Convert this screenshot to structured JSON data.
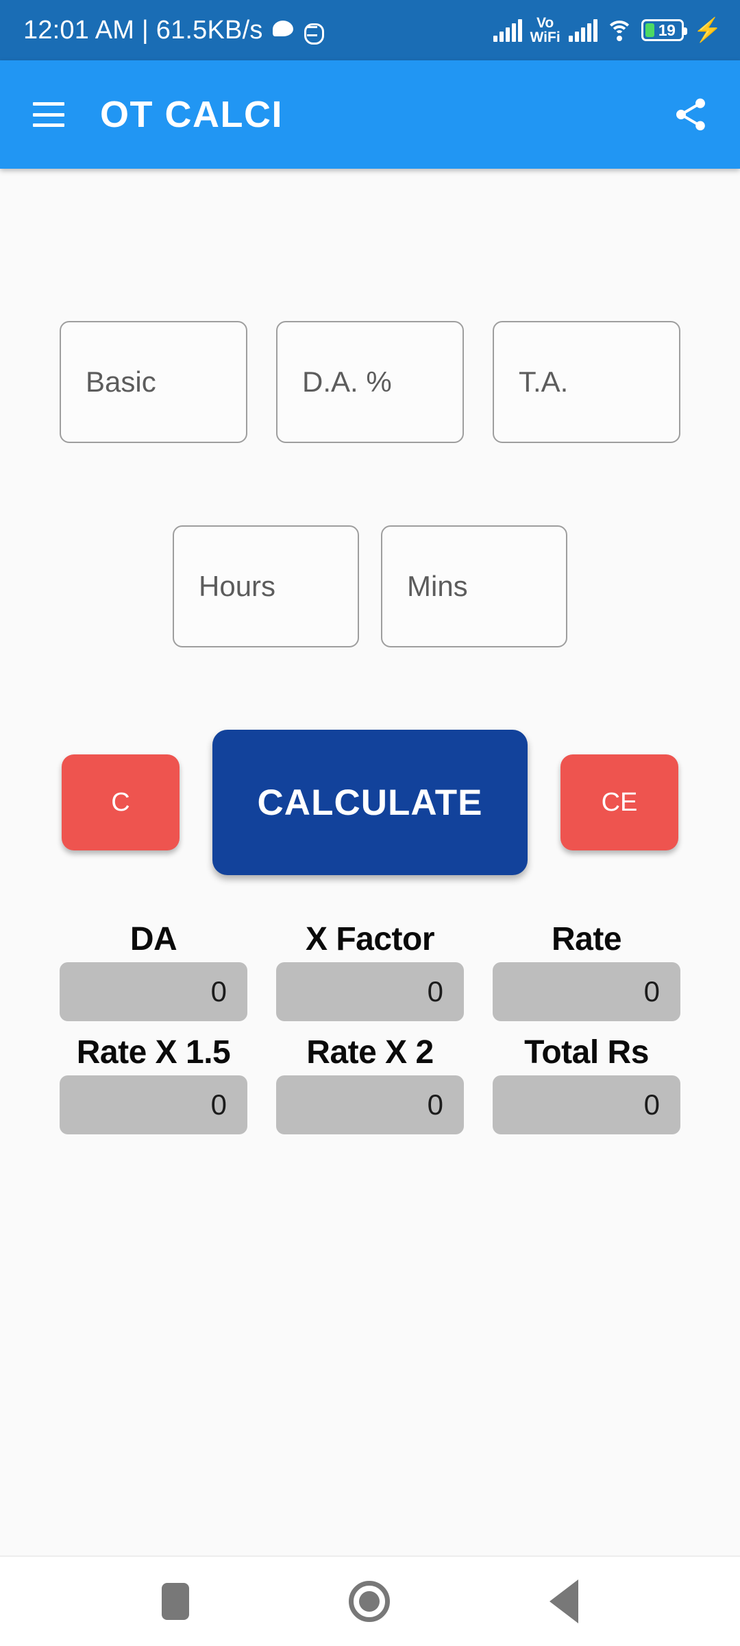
{
  "status_bar": {
    "clock_and_net": "12:01 AM | 61.5KB/s",
    "chat_icon": "chat-bubble-icon",
    "robot_icon": "android-robot-icon",
    "signal_icon": "cellular-signal-icon",
    "vo_line1": "Vo",
    "vo_line2": "WiFi",
    "signal2_icon": "cellular-signal-icon",
    "wifi_icon": "wifi-icon",
    "battery_percent": "19",
    "charging_icon": "charging-bolt-icon",
    "bolt_glyph": "⚡",
    "background_color": "#1A6DB5"
  },
  "app_bar": {
    "menu_icon": "hamburger-menu-icon",
    "title": "OT CALCI",
    "share_icon": "share-icon",
    "background_color": "#2196F3",
    "text_color": "#FFFFFF"
  },
  "inputs": {
    "row1": [
      {
        "name": "basic",
        "placeholder": "Basic",
        "value": ""
      },
      {
        "name": "da-percent",
        "placeholder": "D.A. %",
        "value": ""
      },
      {
        "name": "ta",
        "placeholder": "T.A.",
        "value": ""
      }
    ],
    "row2": [
      {
        "name": "hours",
        "placeholder": "Hours",
        "value": ""
      },
      {
        "name": "mins",
        "placeholder": "Mins",
        "value": ""
      }
    ],
    "border_color": "#9E9E9E",
    "placeholder_color": "#5C5C5C"
  },
  "buttons": {
    "clear_label": "C",
    "calculate_label": "CALCULATE",
    "clear_entry_label": "CE",
    "clear_color": "#EE544F",
    "calculate_color": "#12429B",
    "text_color": "#FFFFFF"
  },
  "results": {
    "box_color": "#BDBDBD",
    "row1": [
      {
        "label": "DA",
        "value": "0"
      },
      {
        "label": "X Factor",
        "value": "0"
      },
      {
        "label": "Rate",
        "value": "0"
      }
    ],
    "row2": [
      {
        "label": "Rate X 1.5",
        "value": "0"
      },
      {
        "label": "Rate X 2",
        "value": "0"
      },
      {
        "label": "Total Rs",
        "value": "0"
      }
    ]
  },
  "nav_bar": {
    "recents_icon": "recents-square-icon",
    "home_icon": "home-circle-icon",
    "back_icon": "back-triangle-icon",
    "background_color": "#FFFFFF"
  },
  "page": {
    "background_color": "#FAFAFA"
  }
}
